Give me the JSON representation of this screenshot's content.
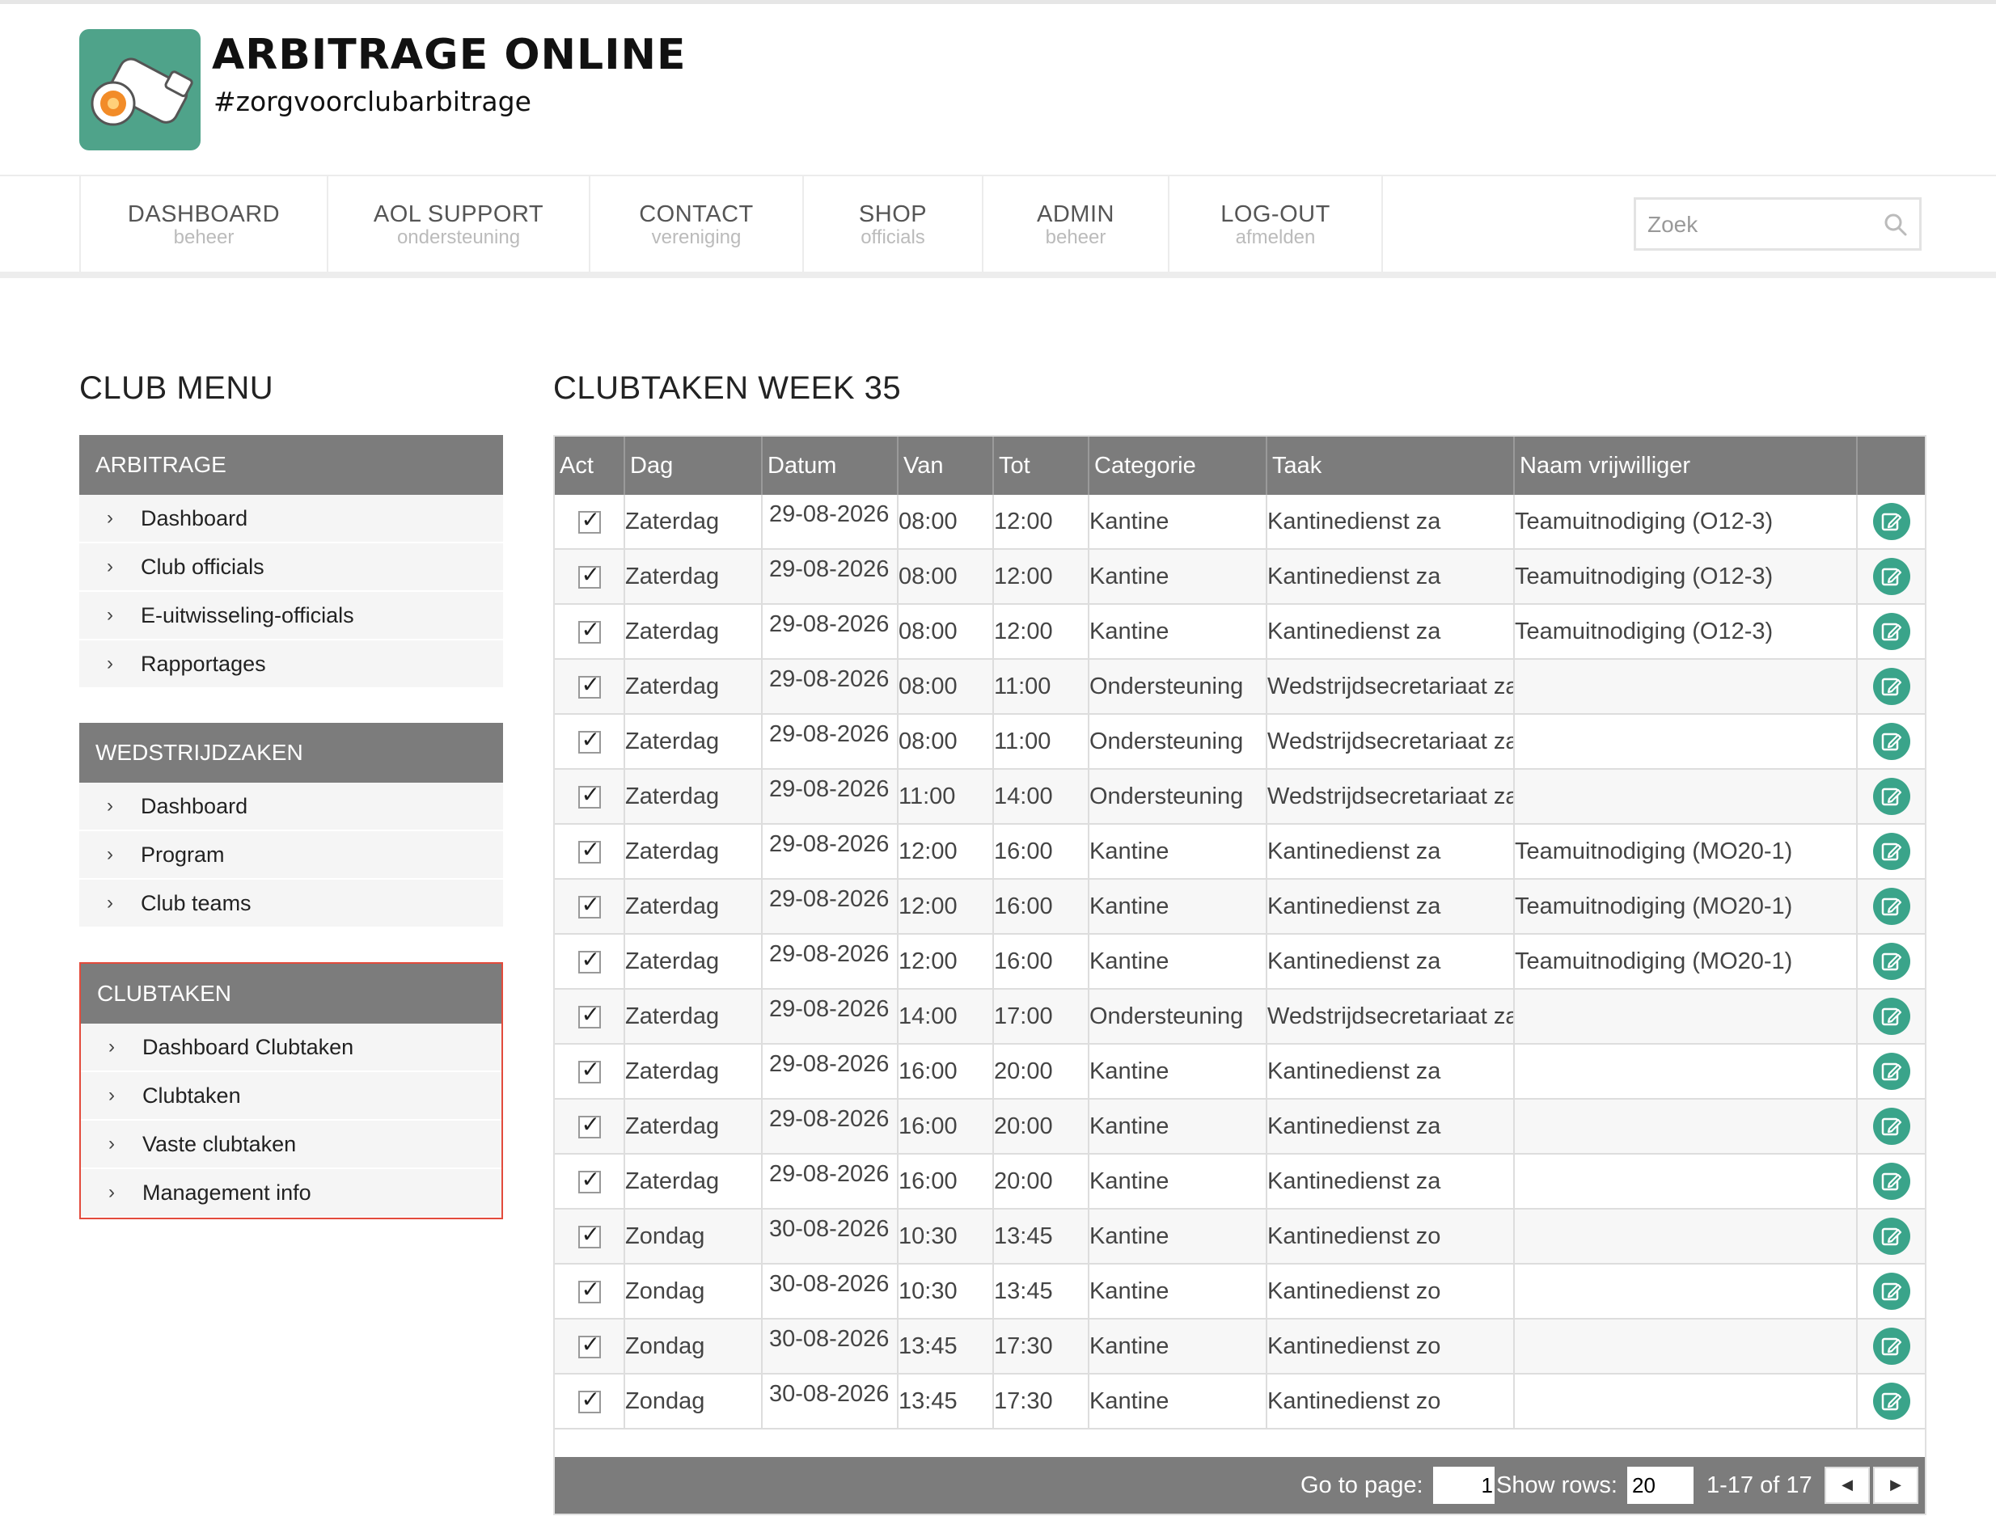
{
  "brand": {
    "title": "ARBITRAGE ONLINE",
    "tagline": "#zorgvoorclubarbitrage"
  },
  "nav": {
    "items": [
      {
        "label": "DASHBOARD",
        "sub": "beheer"
      },
      {
        "label": "AOL SUPPORT",
        "sub": "ondersteuning"
      },
      {
        "label": "CONTACT",
        "sub": "vereniging"
      },
      {
        "label": "SHOP",
        "sub": "officials"
      },
      {
        "label": "ADMIN",
        "sub": "beheer"
      },
      {
        "label": "LOG-OUT",
        "sub": "afmelden"
      }
    ],
    "search_placeholder": "Zoek"
  },
  "sidebar": {
    "title": "CLUB MENU",
    "groups": [
      {
        "heading": "ARBITRAGE",
        "items": [
          "Dashboard",
          "Club officials",
          "E-uitwisseling-officials",
          "Rapportages"
        ]
      },
      {
        "heading": "WEDSTRIJDZAKEN",
        "items": [
          "Dashboard",
          "Program",
          "Club teams"
        ]
      },
      {
        "heading": "CLUBTAKEN",
        "items": [
          "Dashboard Clubtaken",
          "Clubtaken",
          "Vaste clubtaken",
          "Management info"
        ]
      }
    ]
  },
  "main": {
    "title": "CLUBTAKEN WEEK 35",
    "columns": [
      "Act",
      "Dag",
      "Datum",
      "Van",
      "Tot",
      "Categorie",
      "Taak",
      "Naam vrijwilliger",
      ""
    ],
    "rows": [
      [
        "Zaterdag",
        "29-08-2026",
        "08:00",
        "12:00",
        "Kantine",
        "Kantinedienst za",
        "Teamuitnodiging (O12-3)"
      ],
      [
        "Zaterdag",
        "29-08-2026",
        "08:00",
        "12:00",
        "Kantine",
        "Kantinedienst za",
        "Teamuitnodiging (O12-3)"
      ],
      [
        "Zaterdag",
        "29-08-2026",
        "08:00",
        "12:00",
        "Kantine",
        "Kantinedienst za",
        "Teamuitnodiging (O12-3)"
      ],
      [
        "Zaterdag",
        "29-08-2026",
        "08:00",
        "11:00",
        "Ondersteuning",
        "Wedstrijdsecretariaat za",
        ""
      ],
      [
        "Zaterdag",
        "29-08-2026",
        "08:00",
        "11:00",
        "Ondersteuning",
        "Wedstrijdsecretariaat za",
        ""
      ],
      [
        "Zaterdag",
        "29-08-2026",
        "11:00",
        "14:00",
        "Ondersteuning",
        "Wedstrijdsecretariaat za",
        ""
      ],
      [
        "Zaterdag",
        "29-08-2026",
        "12:00",
        "16:00",
        "Kantine",
        "Kantinedienst za",
        "Teamuitnodiging (MO20-1)"
      ],
      [
        "Zaterdag",
        "29-08-2026",
        "12:00",
        "16:00",
        "Kantine",
        "Kantinedienst za",
        "Teamuitnodiging (MO20-1)"
      ],
      [
        "Zaterdag",
        "29-08-2026",
        "12:00",
        "16:00",
        "Kantine",
        "Kantinedienst za",
        "Teamuitnodiging (MO20-1)"
      ],
      [
        "Zaterdag",
        "29-08-2026",
        "14:00",
        "17:00",
        "Ondersteuning",
        "Wedstrijdsecretariaat za",
        ""
      ],
      [
        "Zaterdag",
        "29-08-2026",
        "16:00",
        "20:00",
        "Kantine",
        "Kantinedienst za",
        ""
      ],
      [
        "Zaterdag",
        "29-08-2026",
        "16:00",
        "20:00",
        "Kantine",
        "Kantinedienst za",
        ""
      ],
      [
        "Zaterdag",
        "29-08-2026",
        "16:00",
        "20:00",
        "Kantine",
        "Kantinedienst za",
        ""
      ],
      [
        "Zondag",
        "30-08-2026",
        "10:30",
        "13:45",
        "Kantine",
        "Kantinedienst zo",
        ""
      ],
      [
        "Zondag",
        "30-08-2026",
        "10:30",
        "13:45",
        "Kantine",
        "Kantinedienst zo",
        ""
      ],
      [
        "Zondag",
        "30-08-2026",
        "13:45",
        "17:30",
        "Kantine",
        "Kantinedienst zo",
        ""
      ],
      [
        "Zondag",
        "30-08-2026",
        "13:45",
        "17:30",
        "Kantine",
        "Kantinedienst zo",
        ""
      ]
    ],
    "pager": {
      "goto_label": "Go to page:",
      "goto_value": "1",
      "rows_label": "Show rows:",
      "rows_value": "20",
      "range": "1-17 of 17"
    }
  },
  "colors": {
    "accent": "#3aa48a",
    "header_gray": "#7c7c7c",
    "active_border": "#e34b3c"
  }
}
